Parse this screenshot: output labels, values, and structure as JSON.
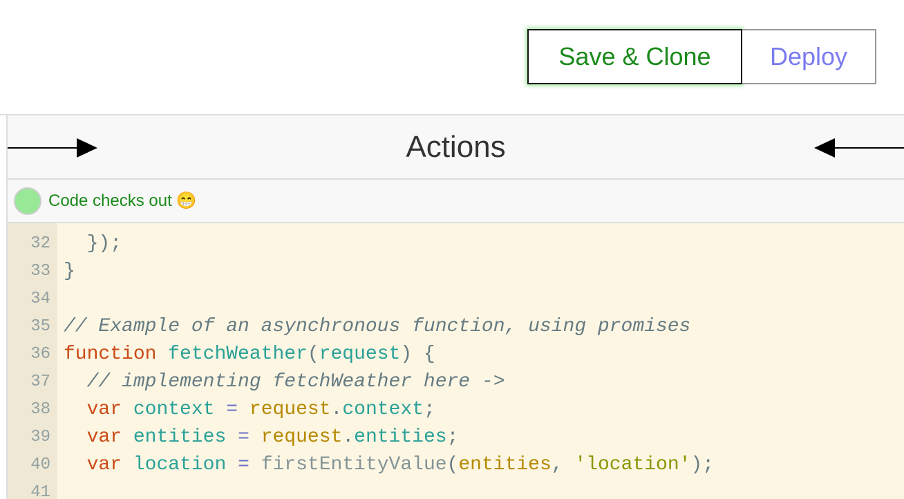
{
  "toolbar": {
    "save_clone_label": "Save & Clone",
    "deploy_label": "Deploy"
  },
  "panel": {
    "title": "Actions"
  },
  "status": {
    "text": "Code checks out",
    "emoji": "😁",
    "color": "#98e898"
  },
  "editor": {
    "lines": [
      {
        "n": "32",
        "tokens": [
          [
            "p",
            "  });"
          ]
        ]
      },
      {
        "n": "33",
        "tokens": [
          [
            "p",
            "}"
          ]
        ]
      },
      {
        "n": "34",
        "tokens": []
      },
      {
        "n": "35",
        "tokens": [
          [
            "cm",
            "// Example of an asynchronous function, using promises"
          ]
        ]
      },
      {
        "n": "36",
        "tokens": [
          [
            "kw",
            "function"
          ],
          [
            "p",
            " "
          ],
          [
            "def",
            "fetchWeather"
          ],
          [
            "p",
            "("
          ],
          [
            "def",
            "request"
          ],
          [
            "p",
            ") {"
          ]
        ]
      },
      {
        "n": "37",
        "tokens": [
          [
            "p",
            "  "
          ],
          [
            "cm",
            "// implementing fetchWeather here ->"
          ]
        ]
      },
      {
        "n": "38",
        "tokens": [
          [
            "p",
            "  "
          ],
          [
            "kw",
            "var"
          ],
          [
            "p",
            " "
          ],
          [
            "def",
            "context"
          ],
          [
            "p",
            " "
          ],
          [
            "op",
            "="
          ],
          [
            "p",
            " "
          ],
          [
            "v2",
            "request"
          ],
          [
            "p",
            "."
          ],
          [
            "def",
            "context"
          ],
          [
            "p",
            ";"
          ]
        ]
      },
      {
        "n": "39",
        "tokens": [
          [
            "p",
            "  "
          ],
          [
            "kw",
            "var"
          ],
          [
            "p",
            " "
          ],
          [
            "def",
            "entities"
          ],
          [
            "p",
            " "
          ],
          [
            "op",
            "="
          ],
          [
            "p",
            " "
          ],
          [
            "v2",
            "request"
          ],
          [
            "p",
            "."
          ],
          [
            "def",
            "entities"
          ],
          [
            "p",
            ";"
          ]
        ]
      },
      {
        "n": "40",
        "tokens": [
          [
            "p",
            "  "
          ],
          [
            "kw",
            "var"
          ],
          [
            "p",
            " "
          ],
          [
            "def",
            "location"
          ],
          [
            "p",
            " "
          ],
          [
            "op",
            "="
          ],
          [
            "p",
            " "
          ],
          [
            "fn",
            "firstEntityValue"
          ],
          [
            "p",
            "("
          ],
          [
            "v2",
            "entities"
          ],
          [
            "p",
            ", "
          ],
          [
            "str",
            "'location'"
          ],
          [
            "p",
            ");"
          ]
        ]
      },
      {
        "n": "41",
        "tokens": []
      }
    ]
  }
}
